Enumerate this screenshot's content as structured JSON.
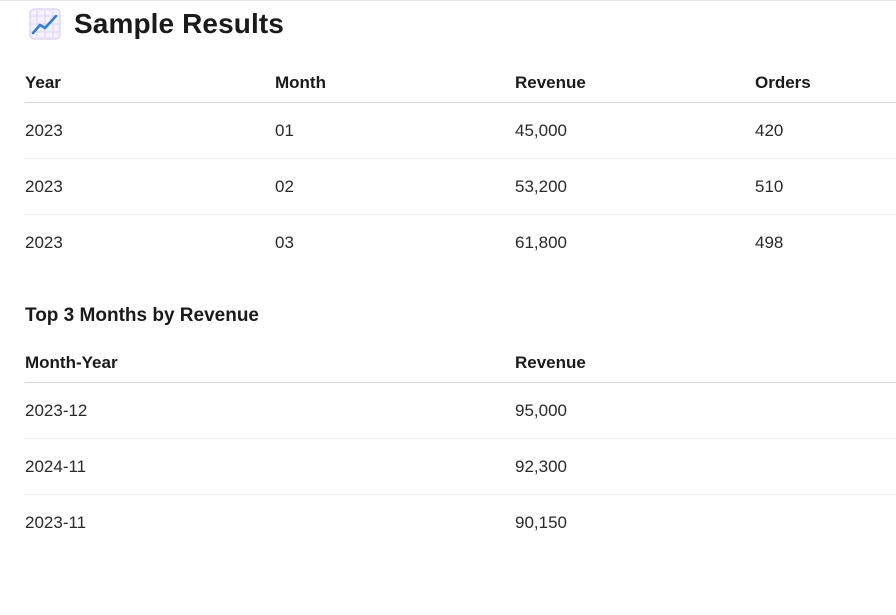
{
  "page": {
    "title": "Sample Results",
    "title_icon": "chart-increasing-icon"
  },
  "results_table": {
    "columns": [
      "Year",
      "Month",
      "Revenue",
      "Orders"
    ],
    "rows": [
      [
        "2023",
        "01",
        "45,000",
        "420"
      ],
      [
        "2023",
        "02",
        "53,200",
        "510"
      ],
      [
        "2023",
        "03",
        "61,800",
        "498"
      ]
    ]
  },
  "top_months": {
    "title": "Top 3 Months by Revenue",
    "columns": [
      "Month-Year",
      "Revenue"
    ],
    "rows": [
      [
        "2023-12",
        "95,000"
      ],
      [
        "2024-11",
        "92,300"
      ],
      [
        "2023-11",
        "90,150"
      ]
    ]
  }
}
